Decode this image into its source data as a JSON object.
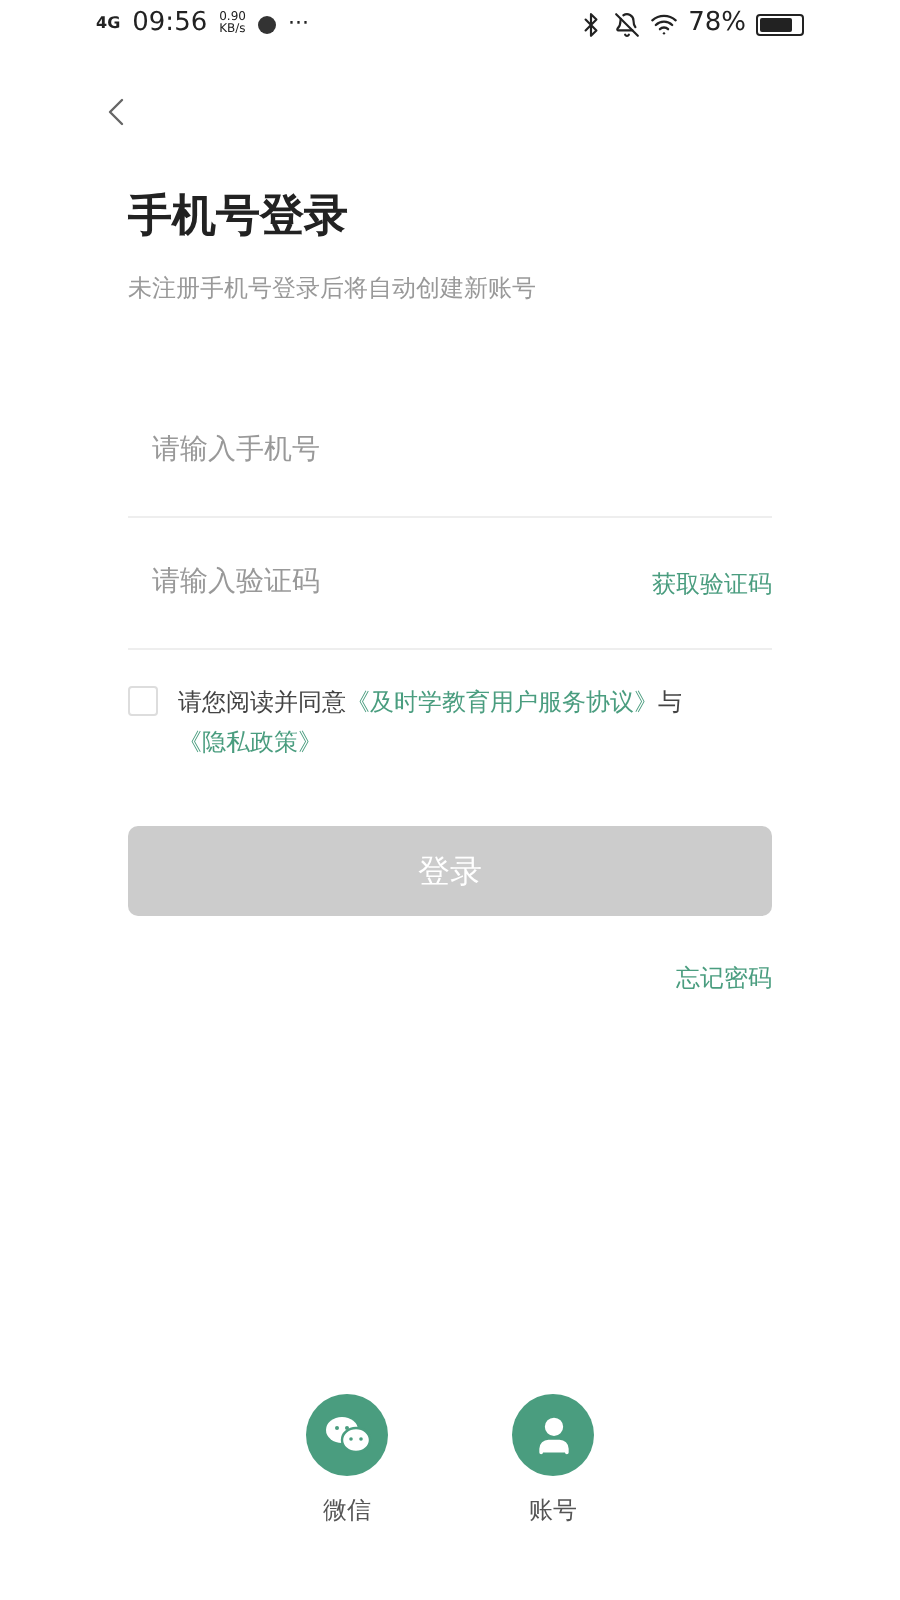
{
  "status_bar": {
    "network": "4G",
    "time": "09:56",
    "speed_value": "0.90",
    "speed_unit": "KB/s",
    "more": "···",
    "battery": "78%"
  },
  "title": "手机号登录",
  "subtitle": "未注册手机号登录后将自动创建新账号",
  "phone_field": {
    "placeholder": "请输入手机号"
  },
  "code_field": {
    "placeholder": "请输入验证码",
    "action": "获取验证码"
  },
  "agreement": {
    "checked": false,
    "parts": [
      {
        "kind": "text",
        "text": "请您阅读并同意"
      },
      {
        "kind": "link",
        "text": "《及时学教育用户服务协议》"
      },
      {
        "kind": "text",
        "text": "与"
      },
      {
        "kind": "link",
        "text": "《隐私政策》"
      }
    ]
  },
  "login_button": {
    "label": "登录",
    "disabled": true
  },
  "forgot_password": "忘记密码",
  "other_logins": [
    {
      "kind": "chat",
      "label": "微信"
    },
    {
      "kind": "person",
      "label": "账号"
    }
  ]
}
